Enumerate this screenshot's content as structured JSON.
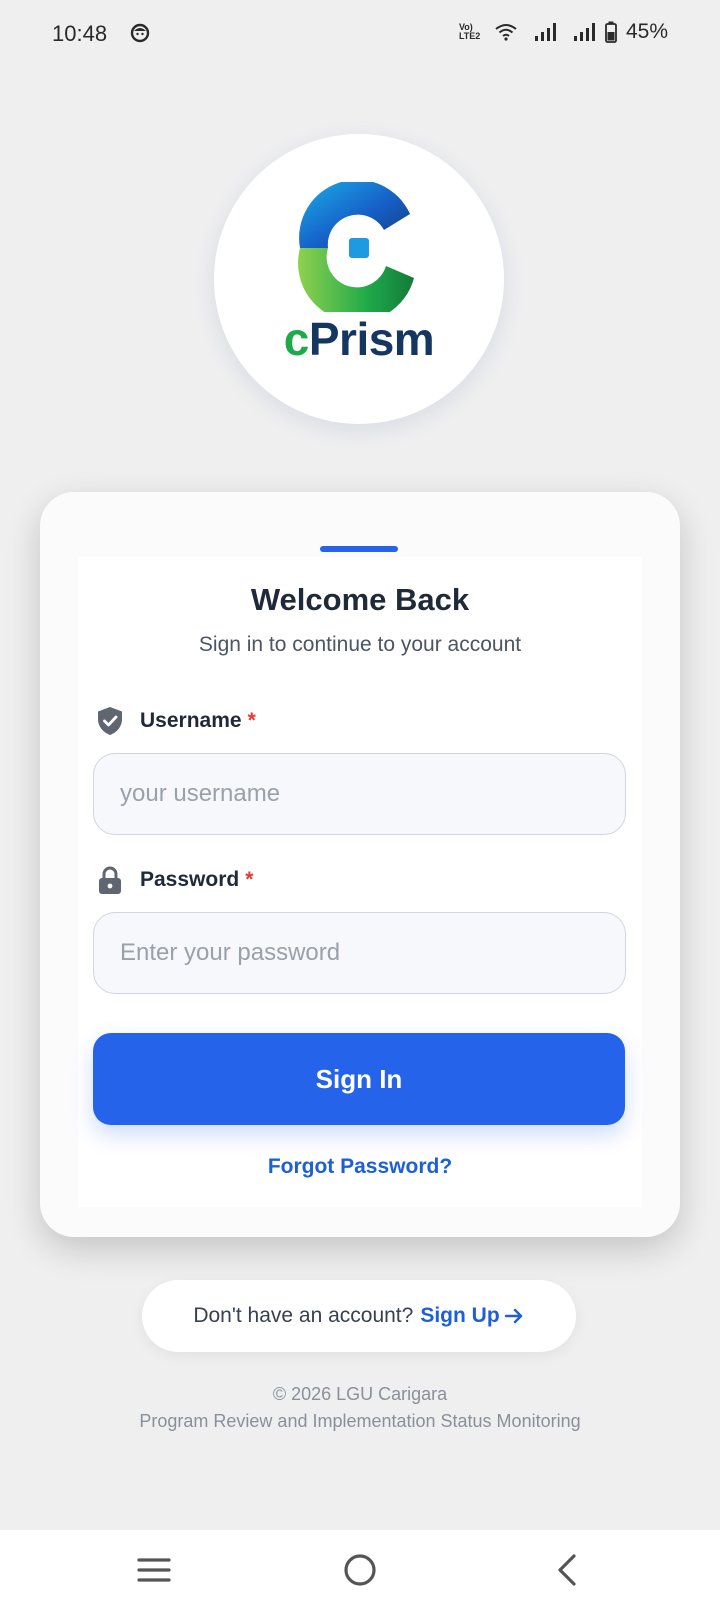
{
  "status_bar": {
    "time": "10:48",
    "network_label": "Vo) LTE2",
    "battery_percent": "45%",
    "icons": [
      "face-notification-icon",
      "wifi-icon",
      "signal-icon",
      "signal-icon",
      "battery-icon"
    ]
  },
  "logo": {
    "brand_prefix": "c",
    "brand_suffix": "Prism",
    "colors": {
      "green": "#1faa4a",
      "navy": "#14365f",
      "blue": "#1a73e8"
    }
  },
  "login": {
    "title": "Welcome Back",
    "subtitle": "Sign in to continue to your account",
    "username_label": "Username",
    "username_placeholder": "your username",
    "username_value": "",
    "password_label": "Password",
    "password_placeholder": "Enter your password",
    "password_value": "",
    "required_mark": "*",
    "signin_label": "Sign In",
    "forgot_label": "Forgot Password?"
  },
  "signup": {
    "question": "Don't have an account?",
    "link_label": "Sign Up"
  },
  "footer": {
    "copyright": "© 2026 LGU Carigara",
    "tagline": "Program Review and Implementation Status Monitoring"
  },
  "nav": {
    "icons": [
      "recent-apps-icon",
      "home-icon",
      "back-icon"
    ]
  },
  "theme": {
    "accent": "#2563eb",
    "link": "#1d5fd6",
    "required": "#e53935",
    "background": "#efeff0"
  }
}
